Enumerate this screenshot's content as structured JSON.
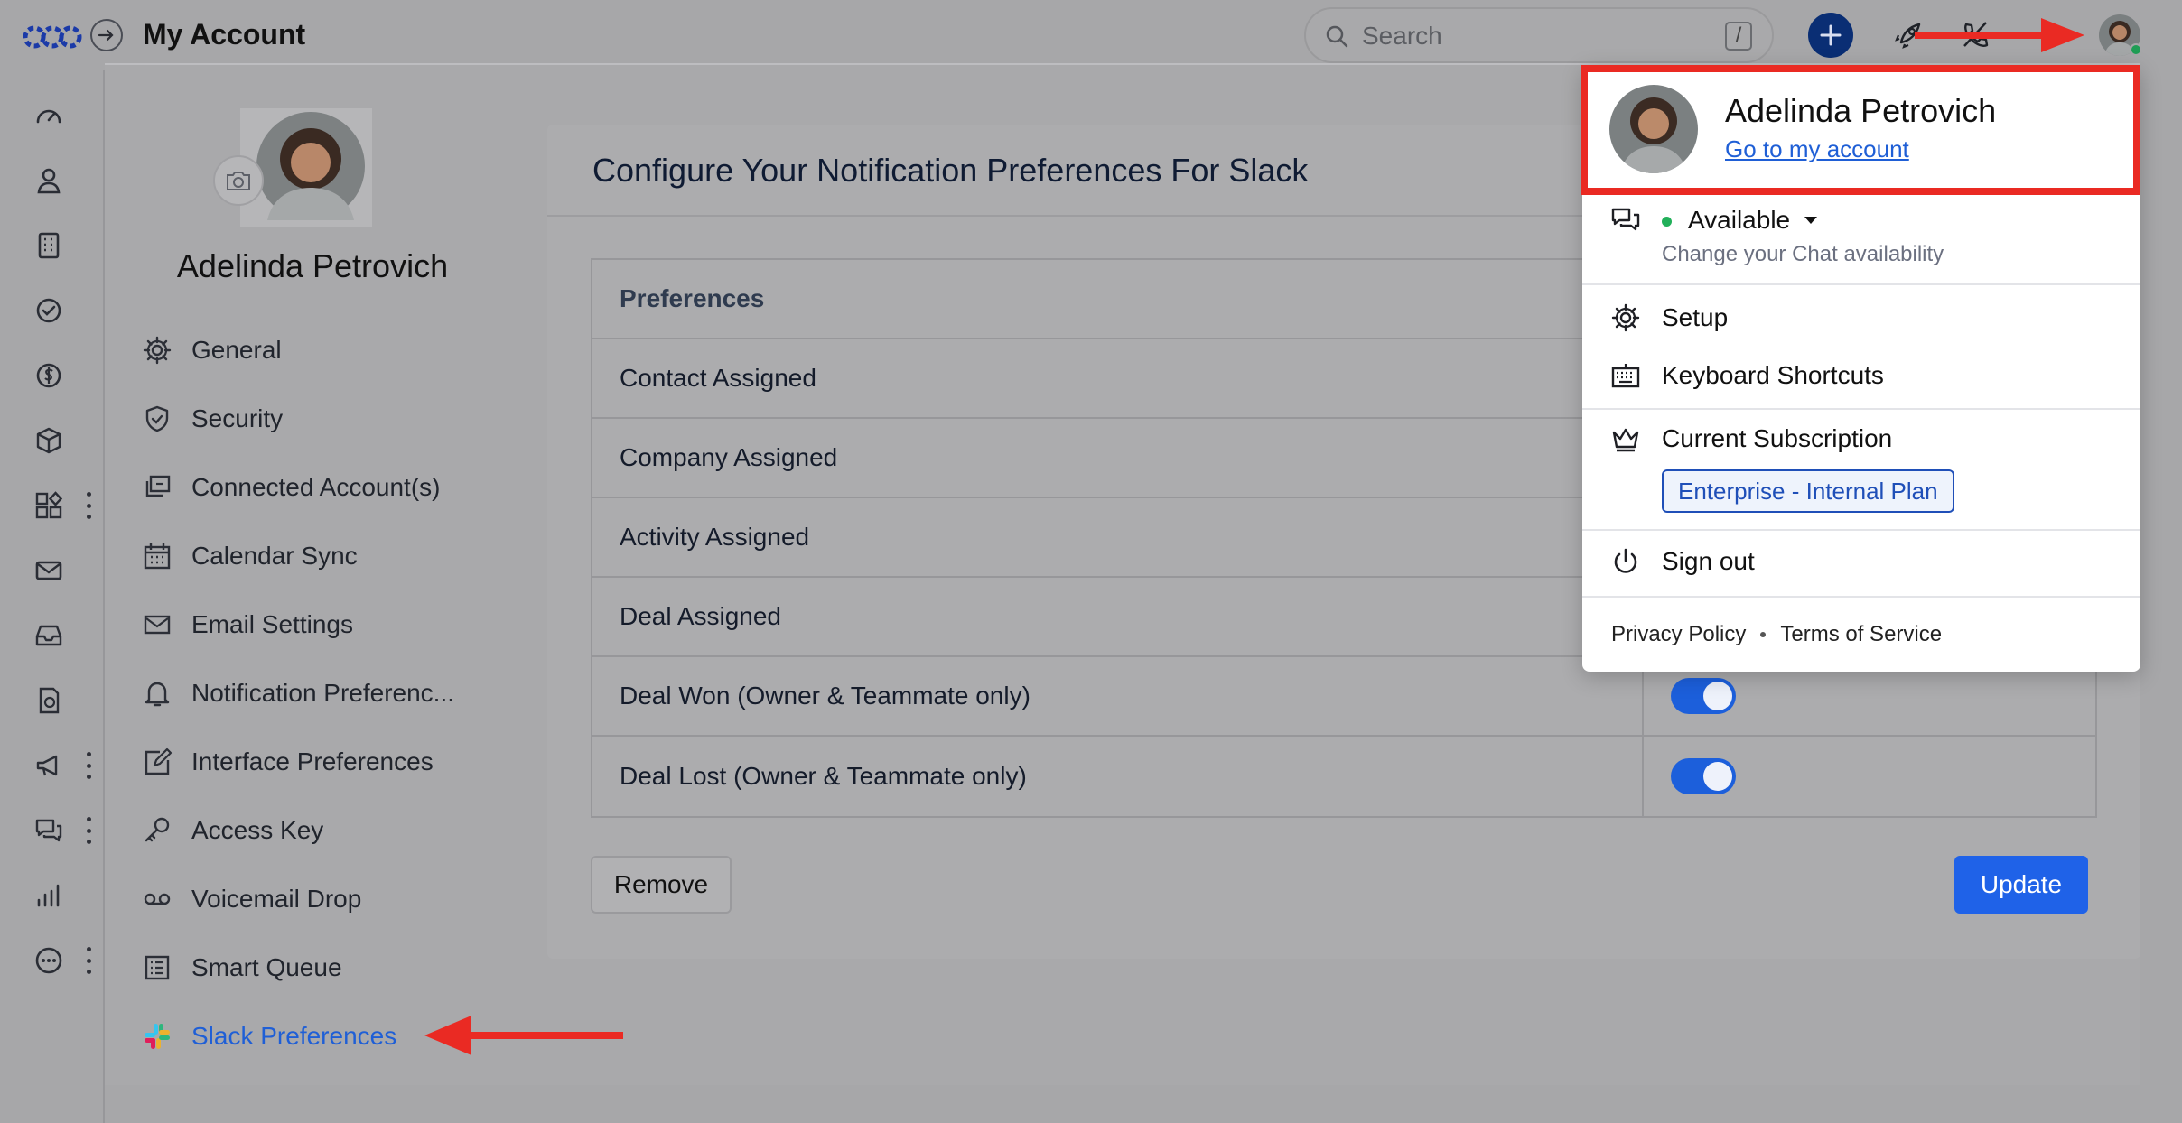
{
  "app": {
    "title": "My Account"
  },
  "search": {
    "placeholder": "Search",
    "shortcut": "/"
  },
  "profile": {
    "name": "Adelinda Petrovich"
  },
  "nav": {
    "items": [
      {
        "label": "General",
        "icon": "gear-icon"
      },
      {
        "label": "Security",
        "icon": "shield-icon"
      },
      {
        "label": "Connected Account(s)",
        "icon": "connected-accounts-icon"
      },
      {
        "label": "Calendar Sync",
        "icon": "calendar-icon"
      },
      {
        "label": "Email Settings",
        "icon": "envelope-icon"
      },
      {
        "label": "Notification Preferenc...",
        "icon": "bell-icon"
      },
      {
        "label": "Interface Preferences",
        "icon": "edit-icon"
      },
      {
        "label": "Access Key",
        "icon": "key-icon"
      },
      {
        "label": "Voicemail Drop",
        "icon": "voicemail-icon"
      },
      {
        "label": "Smart Queue",
        "icon": "list-icon"
      },
      {
        "label": "Slack Preferences",
        "icon": "slack-icon",
        "active": true
      }
    ]
  },
  "card": {
    "title": "Configure Your Notification Preferences For Slack",
    "table_header": "Preferences",
    "rows": [
      {
        "label": "Contact Assigned"
      },
      {
        "label": "Company Assigned"
      },
      {
        "label": "Activity Assigned"
      },
      {
        "label": "Deal Assigned"
      },
      {
        "label": "Deal Won (Owner & Teammate only)",
        "enabled": true
      },
      {
        "label": "Deal Lost (Owner & Teammate only)",
        "enabled": true
      }
    ],
    "remove_label": "Remove",
    "update_label": "Update"
  },
  "dropdown": {
    "name": "Adelinda Petrovich",
    "account_link": "Go to my account",
    "status": "Available",
    "status_sub": "Change your Chat availability",
    "setup": "Setup",
    "shortcuts": "Keyboard Shortcuts",
    "subscription": "Current Subscription",
    "plan": "Enterprise - Internal Plan",
    "signout": "Sign out",
    "privacy": "Privacy Policy",
    "terms": "Terms of Service"
  },
  "colors": {
    "accent": "#1f62e8",
    "annotation": "#ea2a23",
    "online": "#22b05a"
  }
}
